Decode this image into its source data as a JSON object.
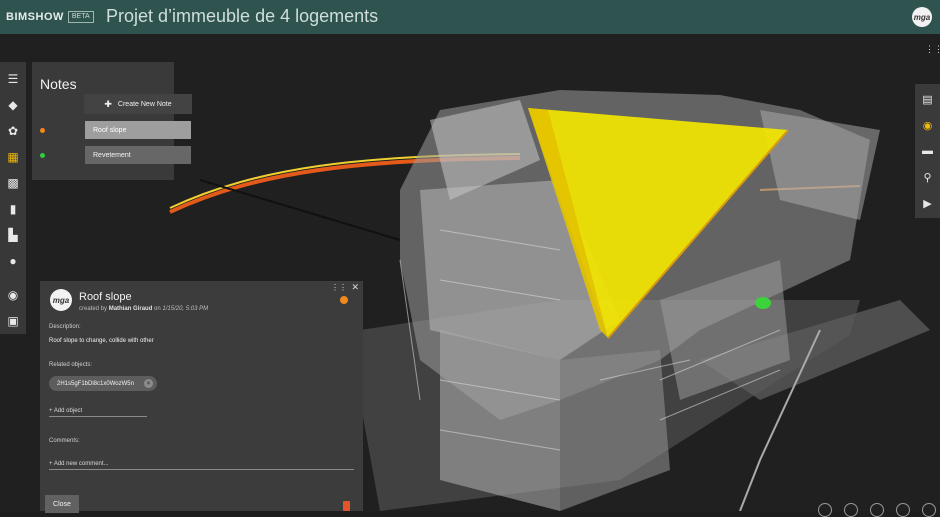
{
  "app": {
    "logo": "BIMSHOW",
    "beta": "BETA",
    "title": "Projet d’immeuble de 4 logements",
    "user_initials": "mga"
  },
  "left_toolbar": [
    {
      "name": "list-icon",
      "active": false
    },
    {
      "name": "layers-icon",
      "active": false
    },
    {
      "name": "objects-icon",
      "active": false
    },
    {
      "name": "notes-icon",
      "active": true
    },
    {
      "name": "image-icon",
      "active": false
    },
    {
      "name": "tag-icon",
      "active": false
    },
    {
      "name": "paint-roller-icon",
      "active": false
    },
    {
      "name": "play-icon",
      "active": false
    },
    {
      "name": "camera-icon",
      "active": false
    },
    {
      "name": "gallery-icon",
      "active": false
    }
  ],
  "notes": {
    "title": "Notes",
    "create_label": "Create New Note",
    "items": [
      {
        "label": "Roof slope",
        "color": "#f08a1c",
        "selected": true
      },
      {
        "label": "Revetement",
        "color": "#2ecc40",
        "selected": false
      }
    ]
  },
  "detail": {
    "title": "Roof slope",
    "created_prefix": "created by",
    "author": "Mathian Giraud",
    "date_prefix": "on",
    "date": "1/15/20, 5:03 PM",
    "description_label": "Description:",
    "description": "Roof slope to change, collide with other",
    "related_label": "Related objects:",
    "related_objects": [
      "2H1s5gF1bDl8c1x0WozW5n"
    ],
    "add_object": "+ Add object",
    "comments_label": "Comments:",
    "add_comment": "+ Add new comment...",
    "close_label": "Close",
    "status_color": "#f08a1c"
  },
  "right_toolbar": [
    {
      "name": "document-icon",
      "active": false
    },
    {
      "name": "eye-icon",
      "active": true
    },
    {
      "name": "ruler-icon",
      "active": false
    },
    {
      "name": "location-pin-icon",
      "active": false
    },
    {
      "name": "play-icon",
      "active": false
    }
  ],
  "colors": {
    "header": "#2f5450",
    "accent": "#f0b90b",
    "highlight": "#f2e600"
  }
}
